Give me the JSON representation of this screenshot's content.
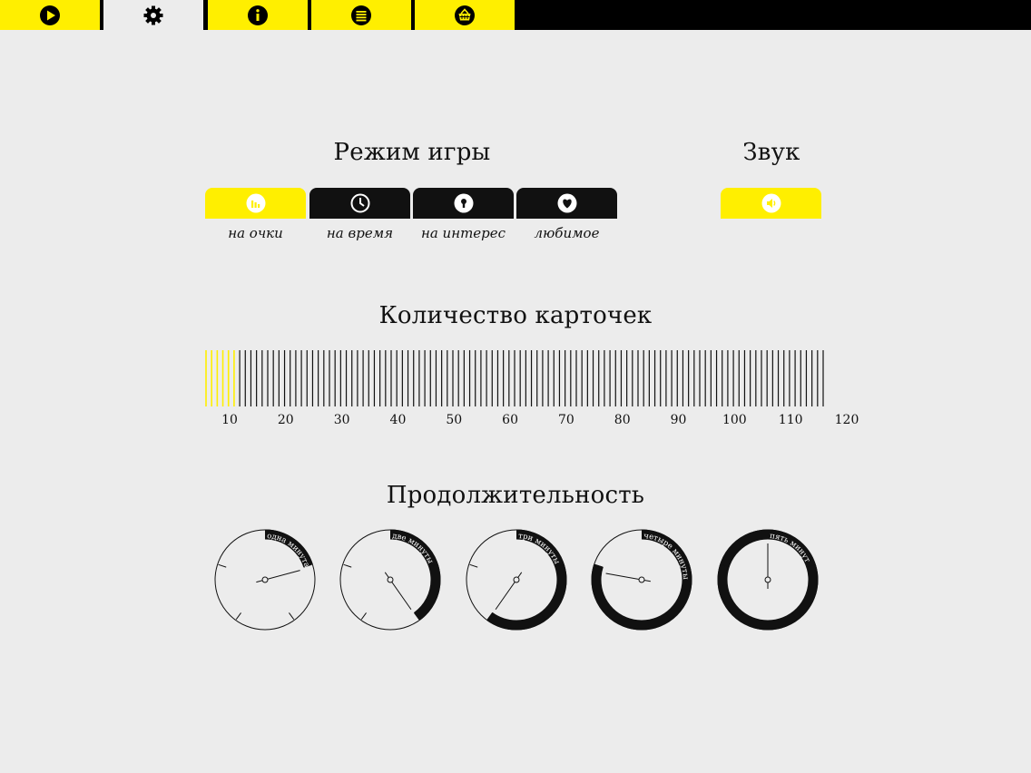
{
  "tabs": [
    {
      "name": "play",
      "icon": "play-icon",
      "active": false
    },
    {
      "name": "settings",
      "icon": "gear-icon",
      "active": true
    },
    {
      "name": "info",
      "icon": "info-icon",
      "active": false
    },
    {
      "name": "list",
      "icon": "list-icon",
      "active": false
    },
    {
      "name": "shop",
      "icon": "basket-icon",
      "active": false
    }
  ],
  "game_mode": {
    "title": "Режим игры",
    "options": [
      {
        "label": "на очки",
        "icon": "chart-icon",
        "selected": true
      },
      {
        "label": "на время",
        "icon": "clock-icon",
        "selected": false
      },
      {
        "label": "на интерес",
        "icon": "keyhole-icon",
        "selected": false
      },
      {
        "label": "любимое",
        "icon": "heart-icon",
        "selected": false
      }
    ]
  },
  "sound": {
    "title": "Звук",
    "icon": "speaker-icon",
    "on": true
  },
  "cards": {
    "title": "Количество карточек",
    "min": 10,
    "max": 120,
    "selected": 15,
    "tick_labels": [
      "10",
      "20",
      "30",
      "40",
      "50",
      "60",
      "70",
      "80",
      "90",
      "100",
      "110",
      "120"
    ]
  },
  "duration": {
    "title": "Продолжительность",
    "options": [
      {
        "label": "одна минута",
        "minutes": 1
      },
      {
        "label": "две минуты",
        "minutes": 2
      },
      {
        "label": "три минуты",
        "minutes": 3
      },
      {
        "label": "четыре минуты",
        "minutes": 4
      },
      {
        "label": "пять минут",
        "minutes": 5
      }
    ]
  },
  "colors": {
    "accent": "#ffef00",
    "dark": "#111111",
    "background": "#ececec"
  }
}
